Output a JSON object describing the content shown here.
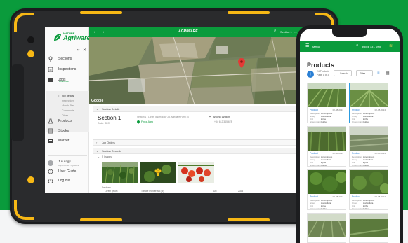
{
  "colors": {
    "brand_green": "#0a9b3c",
    "accent_yellow": "#f7b815",
    "link_blue": "#2a7fd4"
  },
  "tablet": {
    "app_title": "AGRIWARE",
    "logo": {
      "small": "NATURE",
      "big": "Agriware"
    },
    "header": {
      "section_selector": "Section 1 · ..."
    },
    "map": {
      "attribution": "Google"
    },
    "sidebar": {
      "items": [
        {
          "label": "Sections",
          "icon": "location-icon"
        },
        {
          "label": "Inspections",
          "icon": "clipboard-icon"
        },
        {
          "label": "Jobs",
          "icon": "jobs-icon",
          "sublabel": "all views"
        },
        {
          "label": "Products",
          "icon": "flask-icon"
        },
        {
          "label": "Stocks",
          "icon": "stocks-icon"
        },
        {
          "label": "Market",
          "icon": "market-icon"
        }
      ],
      "job_subitems": [
        "Job details",
        "Inspections",
        "Month Plan",
        "Comments",
        "Other"
      ],
      "user": {
        "name": "Juli Angy",
        "role": "Agronomist - Agriware"
      },
      "footer_items": [
        {
          "label": "User Guide",
          "icon": "help-icon"
        },
        {
          "label": "Log out",
          "icon": "power-icon"
        }
      ]
    },
    "section_panel": {
      "header": "Section Details",
      "title": "Section 1",
      "code": "Code: SEC",
      "address": "Section 1 - Lorem ipsum dolor 28, Agriware-Farm 10",
      "farm": "Finca Agro",
      "person": "Antonio Anglon",
      "phone": "+34 612 345 678"
    },
    "job_orders_panel": {
      "header": "Job Orders"
    },
    "records_panel": {
      "header": "Section Records",
      "group1": "5 Images",
      "group2": "Sections",
      "table_cells": [
        "Lorem ipsum",
        "Tomate Ponderosa (rc)",
        "Dic",
        "2024"
      ]
    }
  },
  "phone": {
    "header": {
      "menu_label": "Menu",
      "section_selector": "Block 13 - Veg"
    },
    "title": "Products",
    "count": "24 Products",
    "pages": "Page 1 of 3",
    "search_label": "Search",
    "filter_label": "Filter",
    "cards": [
      {
        "name": "Product",
        "date": "02-08-2024",
        "rows": [
          [
            "Description",
            "Lorem ipsum"
          ],
          [
            "Group",
            "Horticultura"
          ],
          [
            "Unit",
            "kg/ha"
          ],
          [
            "Group mgmt",
            "Cultivo"
          ]
        ]
      },
      {
        "name": "Product",
        "date": "02-08-2024",
        "rows": [
          [
            "Description",
            "Lorem ipsum"
          ],
          [
            "Group",
            "Horticultura"
          ],
          [
            "Unit",
            "kg/ha"
          ],
          [
            "Group mgmt",
            "Cultivo"
          ]
        ]
      },
      {
        "name": "Product",
        "date": "02-08-2024",
        "rows": [
          [
            "Description",
            "Lorem ipsum"
          ],
          [
            "Group",
            "Horticultura"
          ],
          [
            "Unit",
            "kg/ha"
          ],
          [
            "Group mgmt",
            "Cultivo"
          ]
        ]
      },
      {
        "name": "Product",
        "date": "02-08-2024",
        "rows": [
          [
            "Description",
            "Lorem ipsum"
          ],
          [
            "Group",
            "Horticultura"
          ],
          [
            "Unit",
            "kg/ha"
          ],
          [
            "Group mgmt",
            "Cultivo"
          ]
        ]
      },
      {
        "name": "Product",
        "date": "02-08-2024",
        "rows": [
          [
            "Description",
            "Lorem ipsum"
          ],
          [
            "Group",
            "Horticultura"
          ],
          [
            "Unit",
            "kg/ha"
          ],
          [
            "Group mgmt",
            "Cultivo"
          ]
        ]
      },
      {
        "name": "Product",
        "date": "02-08-2024",
        "rows": [
          [
            "Description",
            "Lorem ipsum"
          ],
          [
            "Group",
            "Horticultura"
          ],
          [
            "Unit",
            "kg/ha"
          ],
          [
            "Group mgmt",
            "Cultivo"
          ]
        ]
      }
    ]
  }
}
